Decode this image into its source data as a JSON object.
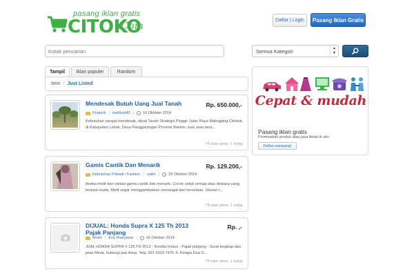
{
  "header": {
    "tagline": "pasang iklan gratis",
    "brand": "CITOKO",
    "brand_suffix": ".Com",
    "login_label": "Daftar | Login",
    "post_ad_label": "Pasang Iklan Gratis"
  },
  "search": {
    "placeholder": "Kotak pencarian",
    "category_selected": "Semua Kategori"
  },
  "tabs": [
    {
      "label": "Tampil",
      "active": true
    },
    {
      "label": "Iklan populer",
      "active": false
    },
    {
      "label": "Random",
      "active": false
    }
  ],
  "breadcrumb": {
    "item": "Item",
    "separator": "/",
    "current": "Just Listed"
  },
  "listings": [
    {
      "title": "Mendesak Butuh Uang Jual Tanah",
      "price": "Rp. 650.000,-",
      "category": "Properti",
      "user": "mahbub40",
      "date": "16 Oktober 2014",
      "description": "Kebutuhan sangat mendesak, dijual Tanah Strategis Pinggir Jalan Raya Malingping Cikotok, di Kabupaten Lebak, Desa Panggarangan Provinsi Banten, luas area tana...",
      "views": "74 total views, 1 today"
    },
    {
      "title": "Gamis Cantik Dan Menarik",
      "price": "Rp. 129.200,-",
      "category": "Kebutuhan Pribadi / Fashion",
      "user": "salim",
      "date": "16 Oktober 2014",
      "description": "Aneka motif dan variasi gamis cantik dan menarik. Cocok untuk remaja atau dewasa yang berjiwa muda. Motif segar menggambarkan semangat dan keceriaan. Ukuran t...",
      "views": "74 total views, 1 today"
    },
    {
      "title": "DIJUAL: Honda Supra X 125 Th 2013 Pajak Panjang",
      "price": "Rp. ,-",
      "category": "Motor",
      "user": "Eny Kharyanie",
      "date": "15 Oktober 2014",
      "description": "JUAL HONDA SUPRA X 125 TH 2013 - Kondisi mulus - Pajak panjang - Surat lengkap dan jelas Minat, hubungi pak Asep. Telp. 021 9333 7475 Jl. Kelapa Dua G...",
      "views": "79 total views, 1 today"
    }
  ],
  "sidebar_ad": {
    "slogan": "Cepat & mudah",
    "title": "Pasang iklan gratis",
    "subtitle": "Promosikan produk atau jasa Anda di sini.",
    "button_label": "Daftar sekarang!"
  },
  "colors": {
    "brand_green": "#3cb043",
    "link_blue": "#1f5ea8",
    "primary_button": "#2466c4",
    "slogan_red": "#c7283a"
  }
}
